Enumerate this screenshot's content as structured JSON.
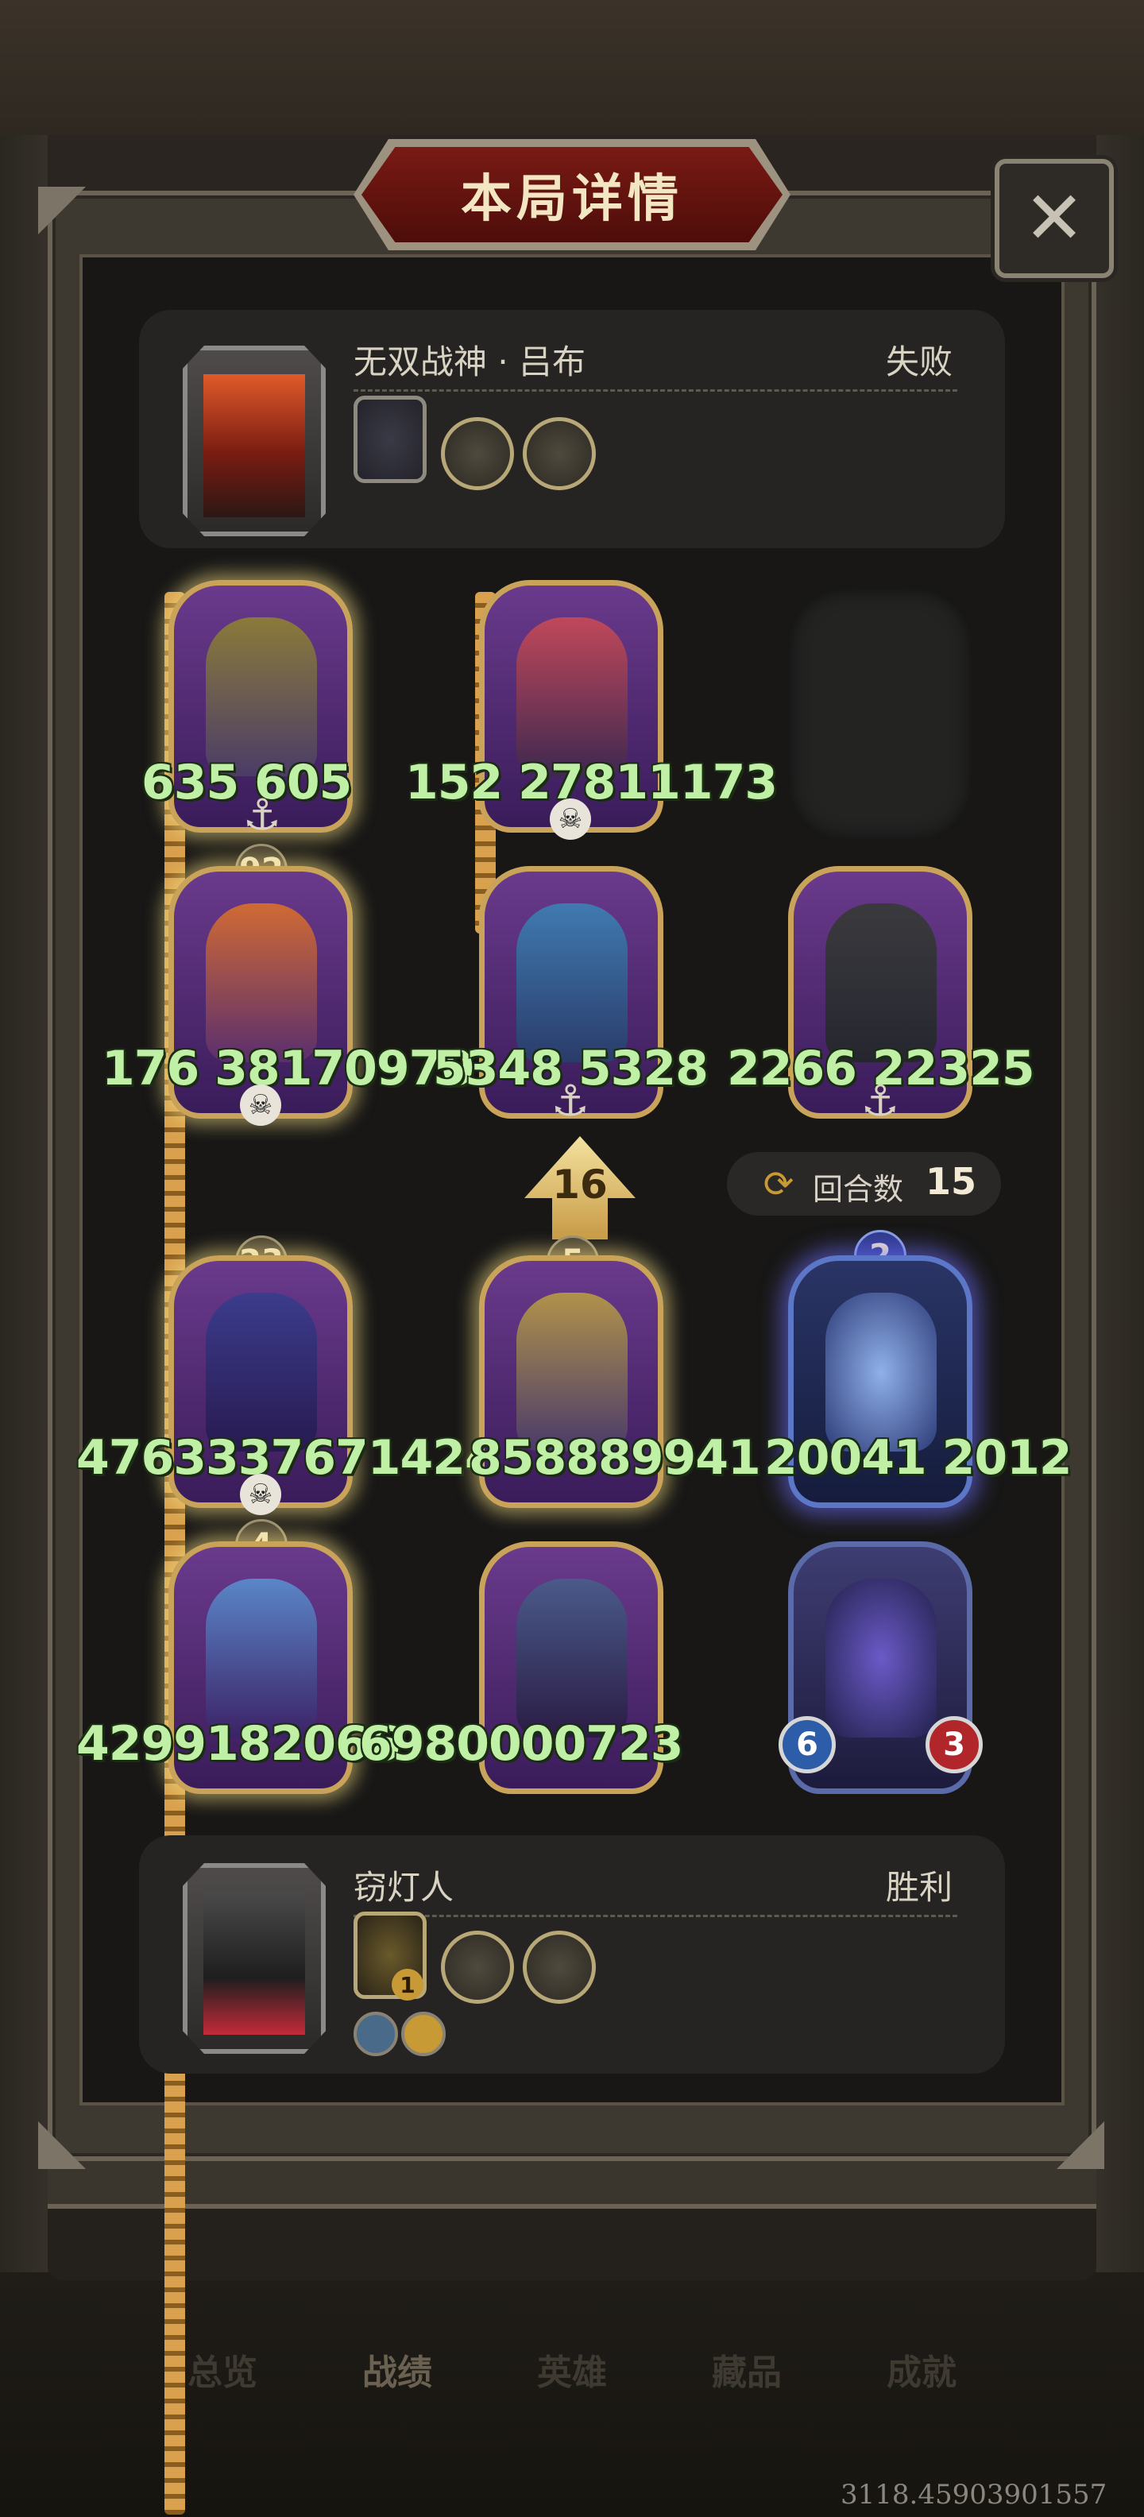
{
  "title": "本局详情",
  "close_glyph": "✕",
  "opponent": {
    "name": "无双战神 · 吕布",
    "result": "失败"
  },
  "player": {
    "name": "窃灯人",
    "result": "胜利",
    "equip_badge": "1"
  },
  "round": {
    "label": "回合数",
    "value": "15"
  },
  "level_up": "16",
  "units": {
    "r1c1": {
      "val": "635 605",
      "atk": "",
      "hp": ""
    },
    "r1c2": {
      "val": "152 27811173",
      "atk": "",
      "hp": ""
    },
    "r2c1": {
      "val": "176 38170970",
      "badge": "92"
    },
    "r2c2": {
      "val": "5348 5328"
    },
    "r2c3": {
      "val": "2266 22325"
    },
    "r3c1": {
      "val": "4763337671424",
      "badge": "23"
    },
    "r3c2": {
      "val": "858889941",
      "badge": "5"
    },
    "r3c3": {
      "val": "20041 2012",
      "badge": "2"
    },
    "r4c1": {
      "val": "4299182066",
      "badge": "4"
    },
    "r4c2": {
      "val": "6980000723"
    },
    "r4c3": {
      "atk": "6",
      "hp": "3"
    }
  },
  "nav": [
    "总览",
    "战绩",
    "英雄",
    "藏品",
    "成就"
  ],
  "coords_readout": "3118.45903901557",
  "colors": {
    "accent_gold": "#c9a35a",
    "title_red": "#7a1a14",
    "value_green": "#bff0a6"
  },
  "icons": {
    "close": "close-icon",
    "round": "refresh-arrows-icon",
    "skull": "skull-icon",
    "anchor": "anchor-icon"
  }
}
